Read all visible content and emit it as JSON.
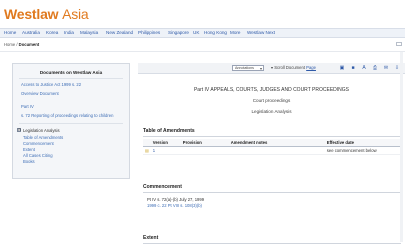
{
  "brand": {
    "name": "Westlaw",
    "suffix": "Asia"
  },
  "top_links": [],
  "nav": {
    "items": [
      "Home",
      "Australia",
      "Korea",
      "India",
      "Malaysia",
      "New Zealand",
      "Philippines",
      "Singapore",
      "UK",
      "Hong Kong",
      "More",
      "Westlaw Next"
    ]
  },
  "breadcrumb": {
    "home": "Home",
    "sep": " / ",
    "current": "Document"
  },
  "sidebar": {
    "title": "Documents on Westlaw Asia",
    "links": [
      "Access to Justice Act 1999 s. 22",
      "Overview Document",
      "Part IV",
      "s. 72 Reporting of proceedings relating to children"
    ],
    "expand_symbol": "⊟",
    "legislation_label": "Legislation Analysis",
    "sub_items": [
      "Table of Amendments",
      "Commencement",
      "Extent",
      "All Cases Citing",
      "Books"
    ]
  },
  "toolbar": {
    "annotations_label": "Annotations",
    "scroll_label": "Scroll Document",
    "page_link": "Page",
    "icons": [
      "document-icon",
      "folder-icon",
      "text-size-icon",
      "print-icon",
      "email-icon",
      "download-icon"
    ]
  },
  "document": {
    "title": "Part IV APPEALS, COURTS, JUDGES AND COURT PROCEEDINGS",
    "subtitle_1": "Court proceedings",
    "subtitle_2": "Legislation Analysis",
    "amendments": {
      "heading": "Table of Amendments",
      "columns": [
        "Version",
        "Provision",
        "Amendment notes",
        "Effective date"
      ],
      "rows": [
        {
          "icon": "▤",
          "version": "1",
          "provision": "",
          "notes": "",
          "effective": "see commencement below"
        }
      ]
    },
    "commencement": {
      "heading": "Commencement",
      "text": "Pt IV s. 72(a)-(b) July 27, 1999",
      "link": "1999 c. 22 Pt VIII s. 108(3)(b)"
    },
    "extent": {
      "heading": "Extent"
    }
  }
}
